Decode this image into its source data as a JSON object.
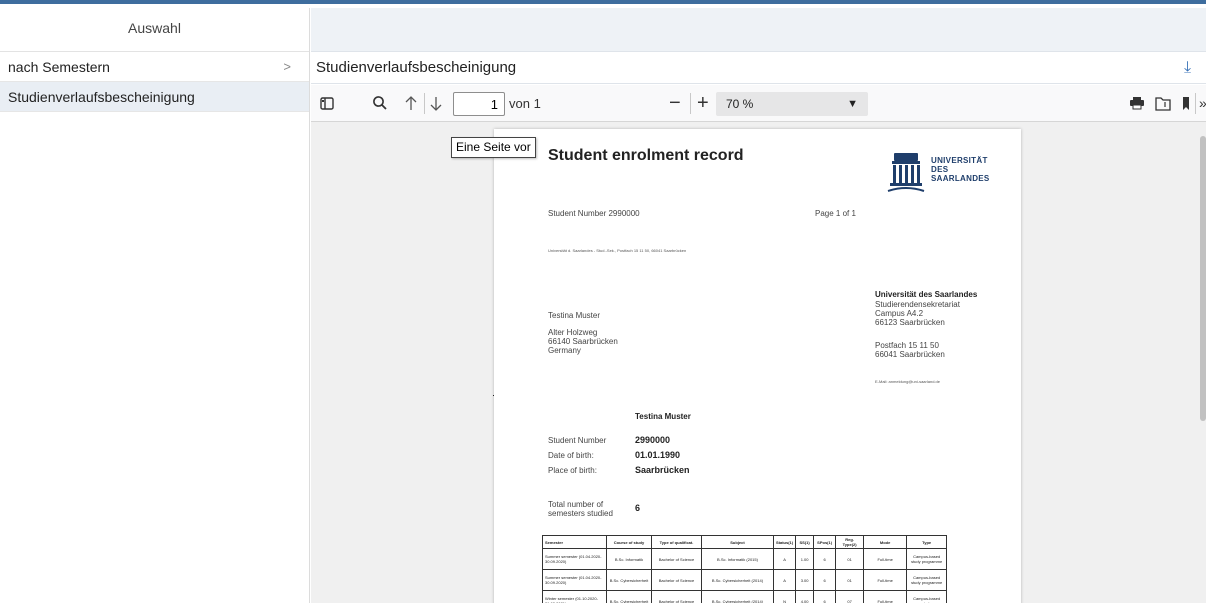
{
  "sidebar": {
    "header": "Auswahl",
    "items": [
      {
        "label": "nach Semestern",
        "chevron": ">"
      },
      {
        "label": "Studienverlaufsbescheinigung"
      }
    ]
  },
  "content": {
    "title": "Studienverlaufsbescheinigung"
  },
  "toolbar": {
    "page_value": "1",
    "page_of": "von 1",
    "zoom": "70 %",
    "tooltip": "Eine Seite vor"
  },
  "document": {
    "title": "Student enrolment record",
    "logo_lines": [
      "UNIVERSITÄT",
      "DES",
      "SAARLANDES"
    ],
    "student_number_line": "Student Number   2990000",
    "page_of": "Page 1 of 1",
    "return_address": "Universität d. Saarlandes - Stud.-Sek., Postfach 15 11 50, 66041 Saarbrücken",
    "recipient": [
      "Testina Muster",
      "Alter Holzweg",
      "66140    Saarbrücken",
      "Germany"
    ],
    "university": {
      "name": "Universität des Saarlandes",
      "lines": [
        "Studierendensekretariat",
        "Campus A4.2",
        "66123 Saarbrücken"
      ],
      "postbox": [
        "Postfach 15 11 50",
        "66041 Saarbrücken"
      ],
      "email": "E-Mail: anmeldung@uni-saarland.de"
    },
    "student_name": "Testina Muster",
    "fields": [
      {
        "label": "Student Number",
        "value": "2990000"
      },
      {
        "label": "Date of birth:",
        "value": "01.01.1990"
      },
      {
        "label": "Place of birth:",
        "value": "Saarbrücken"
      }
    ],
    "semesters_label": [
      "Total number of",
      "semesters studied"
    ],
    "semesters_value": "6",
    "table": {
      "headers": [
        "Semester",
        "Course of study",
        "Type of qualificat.",
        "Subject",
        "Status(1)",
        "SS(1)",
        "SPos(1)",
        "Reg. Type(2)",
        "Mode",
        "Type"
      ],
      "rows": [
        [
          "Summer semester (01.04.2020-30.09.2020)",
          "B.Sc. Informatik",
          "Bachelor of Science",
          "B.Sc. Informatik (2015)",
          "A",
          "1.00",
          "6",
          "01",
          "Full-time",
          "Campus-based study programme"
        ],
        [
          "Summer semester (01.04.2020-30.09.2020)",
          "B.Sc. Cybersicherheit",
          "Bachelor of Science",
          "B.Sc. Cybersicherheit (2014)",
          "A",
          "3.00",
          "6",
          "01",
          "Full-time",
          "Campus-based study programme"
        ],
        [
          "Winter semester (01.10.2020-31.03.2021)",
          "B.Sc. Cybersicherheit",
          "Bachelor of Science",
          "B.Sc. Cybersicherheit (2014)",
          "N",
          "4.00",
          "6",
          "07",
          "Full-time",
          "Campus-based study"
        ]
      ]
    }
  },
  "colors": {
    "top_border": "#3e6d9e",
    "selected_row": "#e9eef4",
    "header_bg": "#eef2f6",
    "download_icon": "#3a73b8",
    "viewer_bg": "#f0f0f0"
  }
}
